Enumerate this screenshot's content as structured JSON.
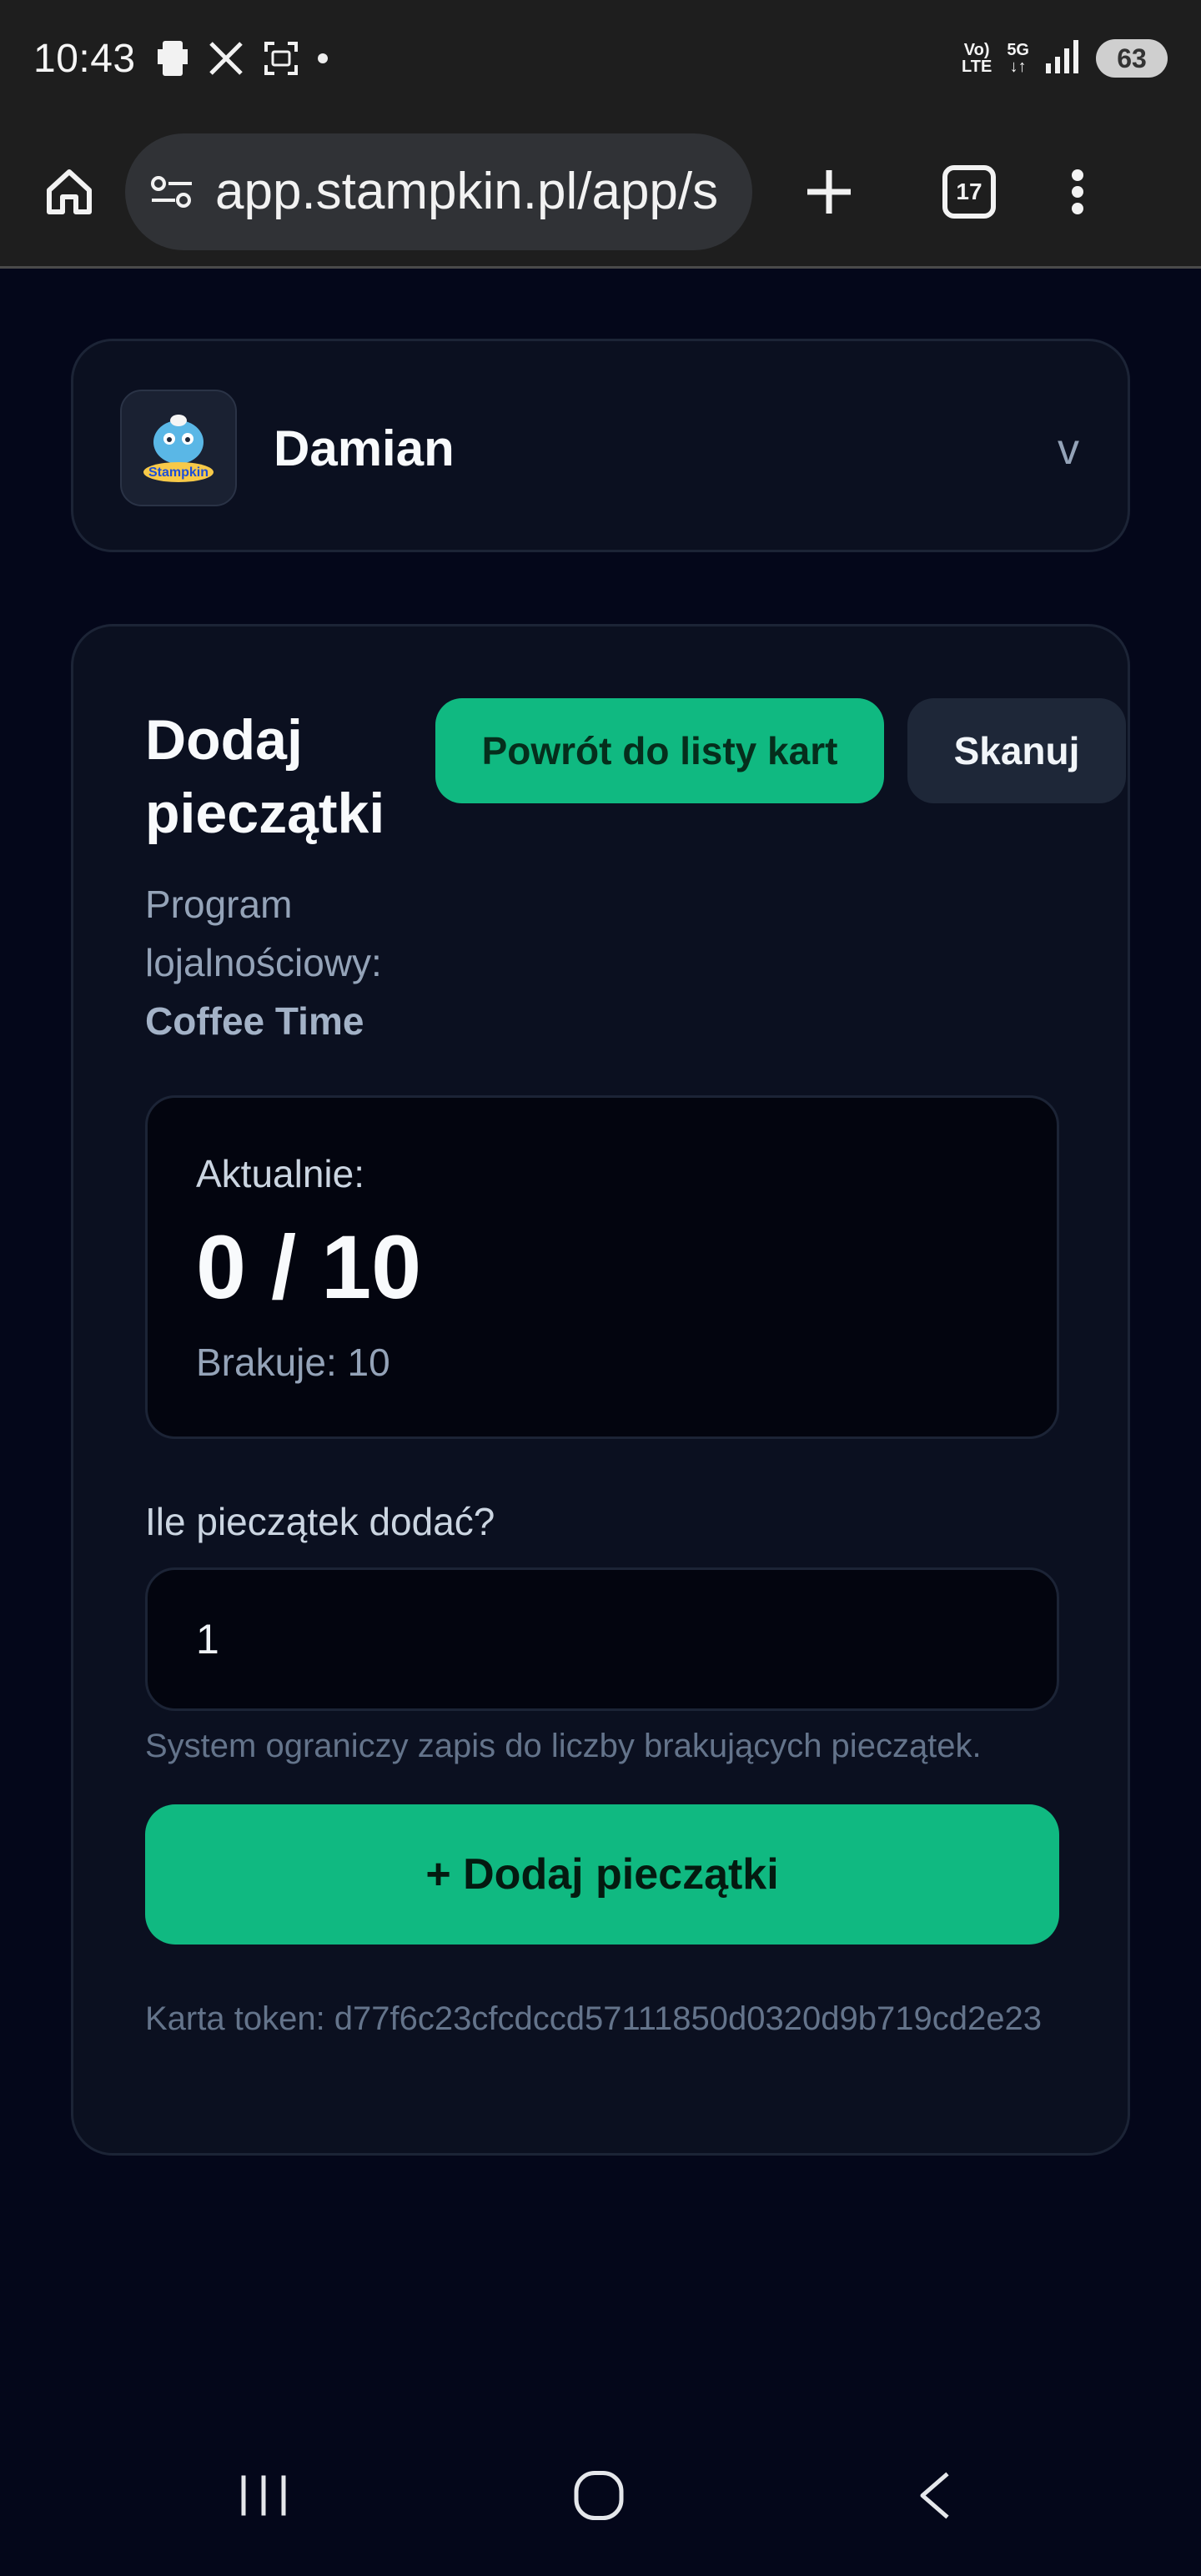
{
  "status_bar": {
    "time": "10:43",
    "net_top": "Vo)",
    "net_bottom": "LTE",
    "net_5g": "5G",
    "battery": "63"
  },
  "browser": {
    "url": "app.stampkin.pl/app/s",
    "tab_count": "17"
  },
  "user": {
    "name": "Damian",
    "chevron": "v",
    "logo_text": "Stampkin"
  },
  "main": {
    "title": "Dodaj pieczątki",
    "program_label": "Program lojalnościowy:",
    "program_name": "Coffee Time",
    "back_button": "Powrót do listy kart",
    "scan_button": "Skanuj",
    "current_label": "Aktualnie:",
    "current_count": "0 / 10",
    "missing_label": "Brakuje: 10",
    "quantity_label": "Ile pieczątek dodać?",
    "quantity_value": "1",
    "hint": "System ograniczy zapis do liczby brakujących pieczątek.",
    "add_button": "+ Dodaj pieczątki",
    "token": "Karta token: d77f6c23cfcdccd57111850d0320d9b719cd2e23"
  },
  "colors": {
    "accent": "#10b981",
    "background": "#04071a",
    "card": "#0b1020"
  }
}
